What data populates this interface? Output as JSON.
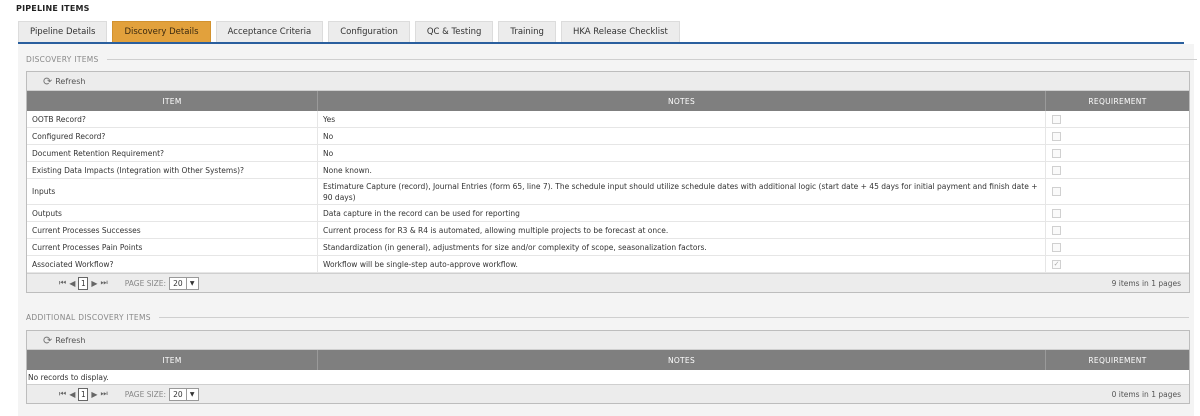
{
  "page": {
    "title": "PIPELINE ITEMS"
  },
  "tabs": [
    {
      "label": "Pipeline Details"
    },
    {
      "label": "Discovery Details"
    },
    {
      "label": "Acceptance Criteria"
    },
    {
      "label": "Configuration"
    },
    {
      "label": "QC & Testing"
    },
    {
      "label": "Training"
    },
    {
      "label": "HKA Release Checklist"
    }
  ],
  "active_tab": "Discovery Details",
  "discovery": {
    "section_title": "DISCOVERY ITEMS",
    "refresh_label": "Refresh",
    "columns": [
      "ITEM",
      "NOTES",
      "REQUIREMENT"
    ],
    "rows": [
      {
        "item": "OOTB Record?",
        "notes": "Yes",
        "requirement": false
      },
      {
        "item": "Configured Record?",
        "notes": "No",
        "requirement": false
      },
      {
        "item": "Document Retention Requirement?",
        "notes": "No",
        "requirement": false
      },
      {
        "item": "Existing Data Impacts (Integration with Other Systems)?",
        "notes": "None known.",
        "requirement": false
      },
      {
        "item": "Inputs",
        "notes": "Estimature Capture (record), Journal Entries (form 65, line 7). The schedule input should utilize schedule dates with additional logic (start date + 45 days for initial payment and finish date + 90 days)",
        "requirement": false
      },
      {
        "item": "Outputs",
        "notes": "Data capture in the record can be used for reporting",
        "requirement": false
      },
      {
        "item": "Current Processes Successes",
        "notes": "Current process for R3 & R4 is automated, allowing multiple projects to be forecast at once.",
        "requirement": false
      },
      {
        "item": "Current Processes Pain Points",
        "notes": "Standardization (in general), adjustments for size and/or complexity of scope, seasonalization factors.",
        "requirement": false
      },
      {
        "item": "Associated Workflow?",
        "notes": "Workflow will be single-step auto-approve workflow.",
        "requirement": true
      }
    ],
    "pager": {
      "page": "1",
      "page_size_label": "PAGE SIZE:",
      "page_size": "20",
      "info": "9 items in 1 pages"
    }
  },
  "additional": {
    "section_title": "ADDITIONAL DISCOVERY ITEMS",
    "refresh_label": "Refresh",
    "columns": [
      "ITEM",
      "NOTES",
      "REQUIREMENT"
    ],
    "empty_message": "No records to display.",
    "pager": {
      "page": "1",
      "page_size_label": "PAGE SIZE:",
      "page_size": "20",
      "info": "0 items in 1 pages"
    }
  }
}
